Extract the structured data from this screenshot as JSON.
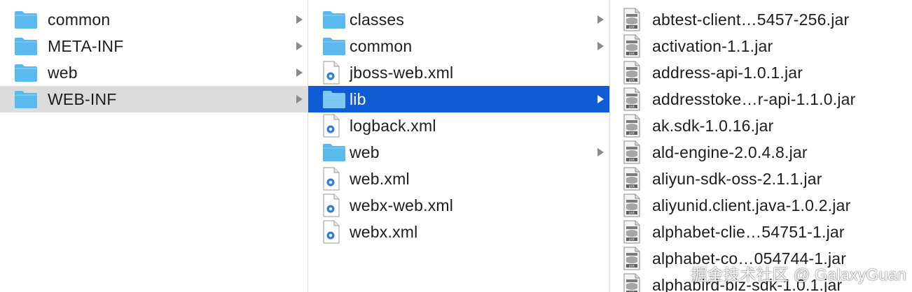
{
  "column1": {
    "items": [
      {
        "label": "common",
        "type": "folder",
        "has_children": true,
        "state": ""
      },
      {
        "label": "META-INF",
        "type": "folder",
        "has_children": true,
        "state": ""
      },
      {
        "label": "web",
        "type": "folder",
        "has_children": true,
        "state": ""
      },
      {
        "label": "WEB-INF",
        "type": "folder",
        "has_children": true,
        "state": "selected-inactive"
      }
    ]
  },
  "column2": {
    "items": [
      {
        "label": "classes",
        "type": "folder",
        "has_children": true,
        "state": ""
      },
      {
        "label": "common",
        "type": "folder",
        "has_children": true,
        "state": ""
      },
      {
        "label": "jboss-web.xml",
        "type": "xml-file",
        "has_children": false,
        "state": ""
      },
      {
        "label": "lib",
        "type": "folder",
        "has_children": true,
        "state": "selected-active"
      },
      {
        "label": "logback.xml",
        "type": "xml-file",
        "has_children": false,
        "state": ""
      },
      {
        "label": "web",
        "type": "folder",
        "has_children": true,
        "state": ""
      },
      {
        "label": "web.xml",
        "type": "xml-file",
        "has_children": false,
        "state": ""
      },
      {
        "label": "webx-web.xml",
        "type": "xml-file",
        "has_children": false,
        "state": ""
      },
      {
        "label": "webx.xml",
        "type": "xml-file",
        "has_children": false,
        "state": ""
      }
    ]
  },
  "column3": {
    "items": [
      {
        "label": "abtest-client…5457-256.jar",
        "type": "jar-file"
      },
      {
        "label": "activation-1.1.jar",
        "type": "jar-file"
      },
      {
        "label": "address-api-1.0.1.jar",
        "type": "jar-file"
      },
      {
        "label": "addresstoke…r-api-1.1.0.jar",
        "type": "jar-file"
      },
      {
        "label": "ak.sdk-1.0.16.jar",
        "type": "jar-file"
      },
      {
        "label": "ald-engine-2.0.4.8.jar",
        "type": "jar-file"
      },
      {
        "label": "aliyun-sdk-oss-2.1.1.jar",
        "type": "jar-file"
      },
      {
        "label": "aliyunid.client.java-1.0.2.jar",
        "type": "jar-file"
      },
      {
        "label": "alphabet-clie…54751-1.jar",
        "type": "jar-file"
      },
      {
        "label": "alphabet-co…054744-1.jar",
        "type": "jar-file"
      },
      {
        "label": "alphabird-biz-sdk-1.0.1.jar",
        "type": "jar-file"
      }
    ]
  },
  "watermark": "掘金技术社区 @ GalaxyGuan",
  "colors": {
    "folder": "#5bb8ee",
    "selected_active": "#0f5cd4",
    "selected_inactive": "#dcdcdc",
    "chevron": "#8a8a8a",
    "separator": "#dcdcdc"
  },
  "icons": {
    "folder": "folder-icon",
    "xml-file": "xml-file-icon",
    "jar-file": "jar-file-icon",
    "chevron": "chevron-right-icon"
  }
}
